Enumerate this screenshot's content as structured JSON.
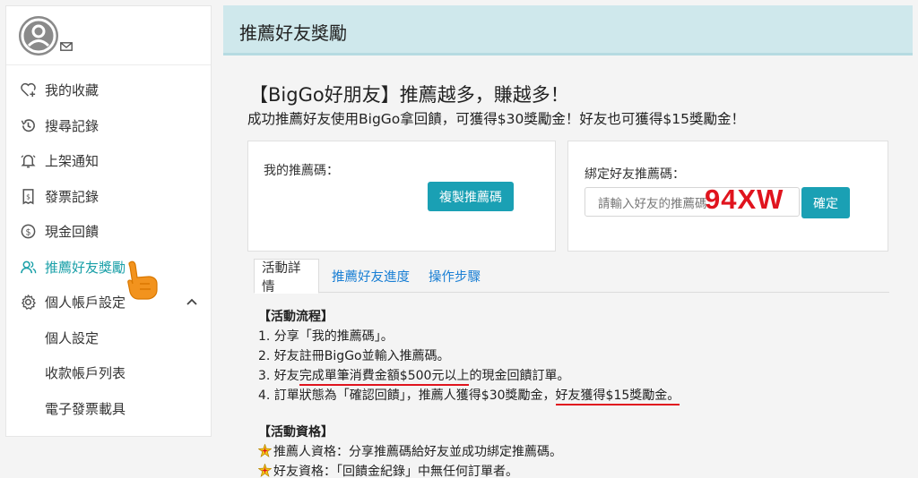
{
  "colors": {
    "accent": "#1aa0b4",
    "active_menu": "#1aa0a8",
    "link": "#1a7fd4",
    "highlight_red": "#e0141e",
    "header_bg": "#cfe8ec"
  },
  "sidebar": {
    "items": [
      {
        "label": "我的收藏",
        "icon": "heart-plus-icon"
      },
      {
        "label": "搜尋記錄",
        "icon": "history-icon"
      },
      {
        "label": "上架通知",
        "icon": "bell-icon"
      },
      {
        "label": "發票記錄",
        "icon": "receipt-icon"
      },
      {
        "label": "現金回饋",
        "icon": "dollar-icon"
      },
      {
        "label": "推薦好友獎勵",
        "icon": "users-icon",
        "active": true
      },
      {
        "label": "個人帳戶設定",
        "icon": "gear-icon"
      }
    ],
    "submenu": [
      {
        "label": "個人設定"
      },
      {
        "label": "收款帳戶列表"
      },
      {
        "label": "電子發票載具"
      }
    ]
  },
  "header": {
    "title": "推薦好友獎勵"
  },
  "promo": {
    "title": "【BigGo好朋友】推薦越多，賺越多！",
    "subtitle": "成功推薦好友使用BigGo拿回饋，可獲得$30獎勵金！好友也可獲得$15獎勵金！"
  },
  "my_code": {
    "label": "我的推薦碼：",
    "copy_button": "複製推薦碼"
  },
  "bind_code": {
    "label": "綁定好友推薦碼：",
    "placeholder": "請輸入好友的推薦碼",
    "confirm_button": "確定",
    "overlay_code": "94XW"
  },
  "tabs": [
    {
      "label": "活動詳情",
      "active": true
    },
    {
      "label": "推薦好友進度"
    },
    {
      "label": "操作步驟"
    }
  ],
  "details": {
    "flow_title": "【活動流程】",
    "flow": [
      {
        "prefix": "1. 分享「我的推薦碼」。"
      },
      {
        "prefix": "2. 好友註冊BigGo並輸入推薦碼。"
      },
      {
        "prefix": "3. 好友",
        "underlined": "完成單筆消費金額$500元以上",
        "suffix": "的現金回饋訂單。"
      },
      {
        "prefix": "4. 訂單狀態為「確認回饋」，推薦人獲得$30獎勵金，",
        "underlined": "好友獲得$15獎勵金。"
      }
    ],
    "eligibility_title": "【活動資格】",
    "eligibility": [
      "推薦人資格：分享推薦碼給好友並成功綁定推薦碼。",
      "好友資格：「回饋金紀錄」中無任何訂單者。"
    ]
  }
}
